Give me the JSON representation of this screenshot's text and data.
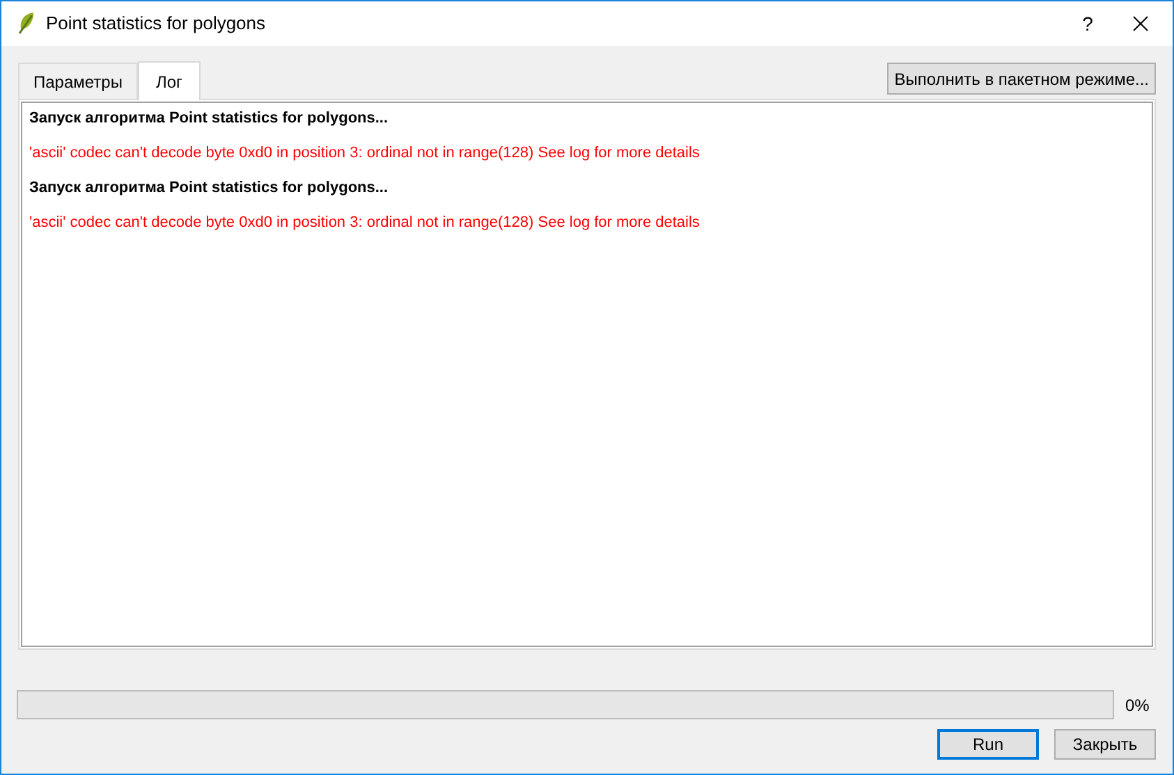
{
  "window": {
    "title": "Point statistics for polygons",
    "help": "?"
  },
  "tabs": [
    {
      "label": "Параметры",
      "selected": false
    },
    {
      "label": "Лог",
      "selected": true
    }
  ],
  "batch_button": "Выполнить в пакетном режиме...",
  "log": [
    {
      "kind": "info",
      "text": "Запуск алгоритма Point statistics for polygons..."
    },
    {
      "kind": "error",
      "text": "'ascii' codec can't decode byte 0xd0 in position 3: ordinal not in range(128) See log for more details"
    },
    {
      "kind": "info",
      "text": "Запуск алгоритма Point statistics for polygons..."
    },
    {
      "kind": "error",
      "text": "'ascii' codec can't decode byte 0xd0 in position 3: ordinal not in range(128) See log for more details"
    }
  ],
  "progress": {
    "level": 0,
    "reading": "0%"
  },
  "buttons": [
    {
      "label": "Run",
      "default": true
    },
    {
      "label": "Закрыть",
      "default": false
    }
  ]
}
